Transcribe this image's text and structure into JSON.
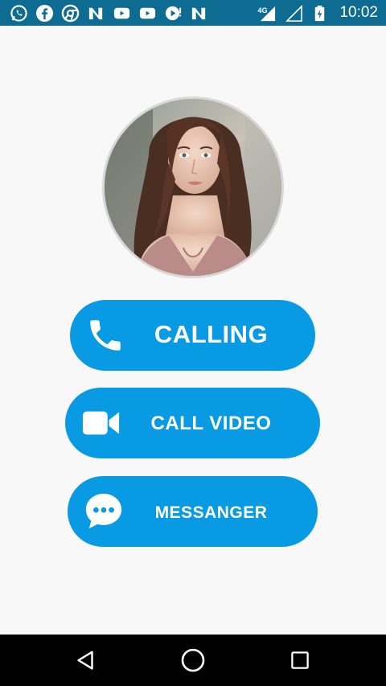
{
  "status_bar": {
    "time": "10:02",
    "network_label": "4G",
    "left_icons": [
      "whatsapp-icon",
      "facebook-icon",
      "chrome-icon",
      "n-app-icon",
      "youtube-icon",
      "youtube-icon",
      "media-icon",
      "n-app-icon"
    ],
    "right_icons": [
      "signal-4g-icon",
      "signal-empty-icon",
      "battery-icon"
    ]
  },
  "profile": {
    "avatar": "profile-photo"
  },
  "actions": {
    "calling_label": "CALLING",
    "call_video_label": "CALL VIDEO",
    "messenger_label": "MESSANGER"
  },
  "colors": {
    "status_bar": "#0e6c93",
    "button": "#089be3",
    "background": "#f8f8f8",
    "nav_bar": "#000000"
  },
  "nav_bar": {
    "buttons": [
      "back-icon",
      "home-icon",
      "recent-apps-icon"
    ]
  }
}
